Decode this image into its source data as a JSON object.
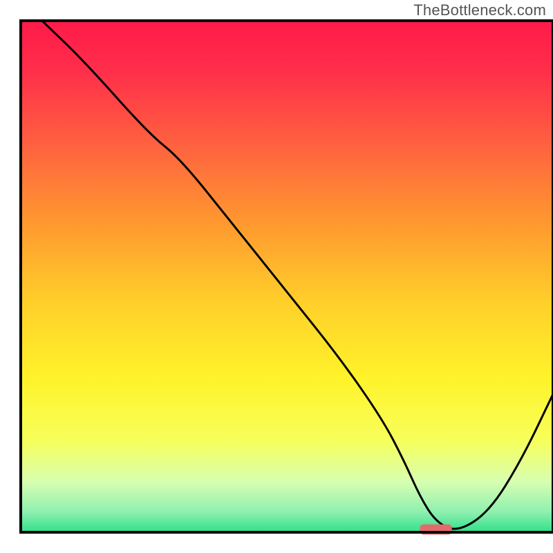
{
  "watermark": "TheBottleneck.com",
  "chart_data": {
    "type": "line",
    "title": "",
    "xlabel": "",
    "ylabel": "",
    "xlim": [
      0,
      100
    ],
    "ylim": [
      0,
      100
    ],
    "series": [
      {
        "name": "curve",
        "x": [
          4,
          12,
          24,
          30,
          40,
          50,
          60,
          68,
          72,
          75,
          78,
          82,
          88,
          94,
          100
        ],
        "values": [
          100,
          92,
          78,
          73,
          60,
          47,
          34,
          22,
          14,
          7,
          2,
          0,
          4,
          14,
          27
        ]
      }
    ],
    "marker": {
      "x": 78,
      "y": 0,
      "width": 6,
      "height": 2
    },
    "gradient_stops": [
      {
        "offset": 0.0,
        "color": "#ff1a4a"
      },
      {
        "offset": 0.1,
        "color": "#ff2f4a"
      },
      {
        "offset": 0.25,
        "color": "#ff643f"
      },
      {
        "offset": 0.4,
        "color": "#ff9a2f"
      },
      {
        "offset": 0.55,
        "color": "#ffcf2a"
      },
      {
        "offset": 0.7,
        "color": "#fff32a"
      },
      {
        "offset": 0.82,
        "color": "#f7ff5a"
      },
      {
        "offset": 0.9,
        "color": "#d8ffb0"
      },
      {
        "offset": 0.96,
        "color": "#8ff0b0"
      },
      {
        "offset": 1.0,
        "color": "#2fdf8a"
      }
    ],
    "frame_color": "#000000",
    "curve_color": "#000000",
    "marker_color": "#e66a6a"
  }
}
